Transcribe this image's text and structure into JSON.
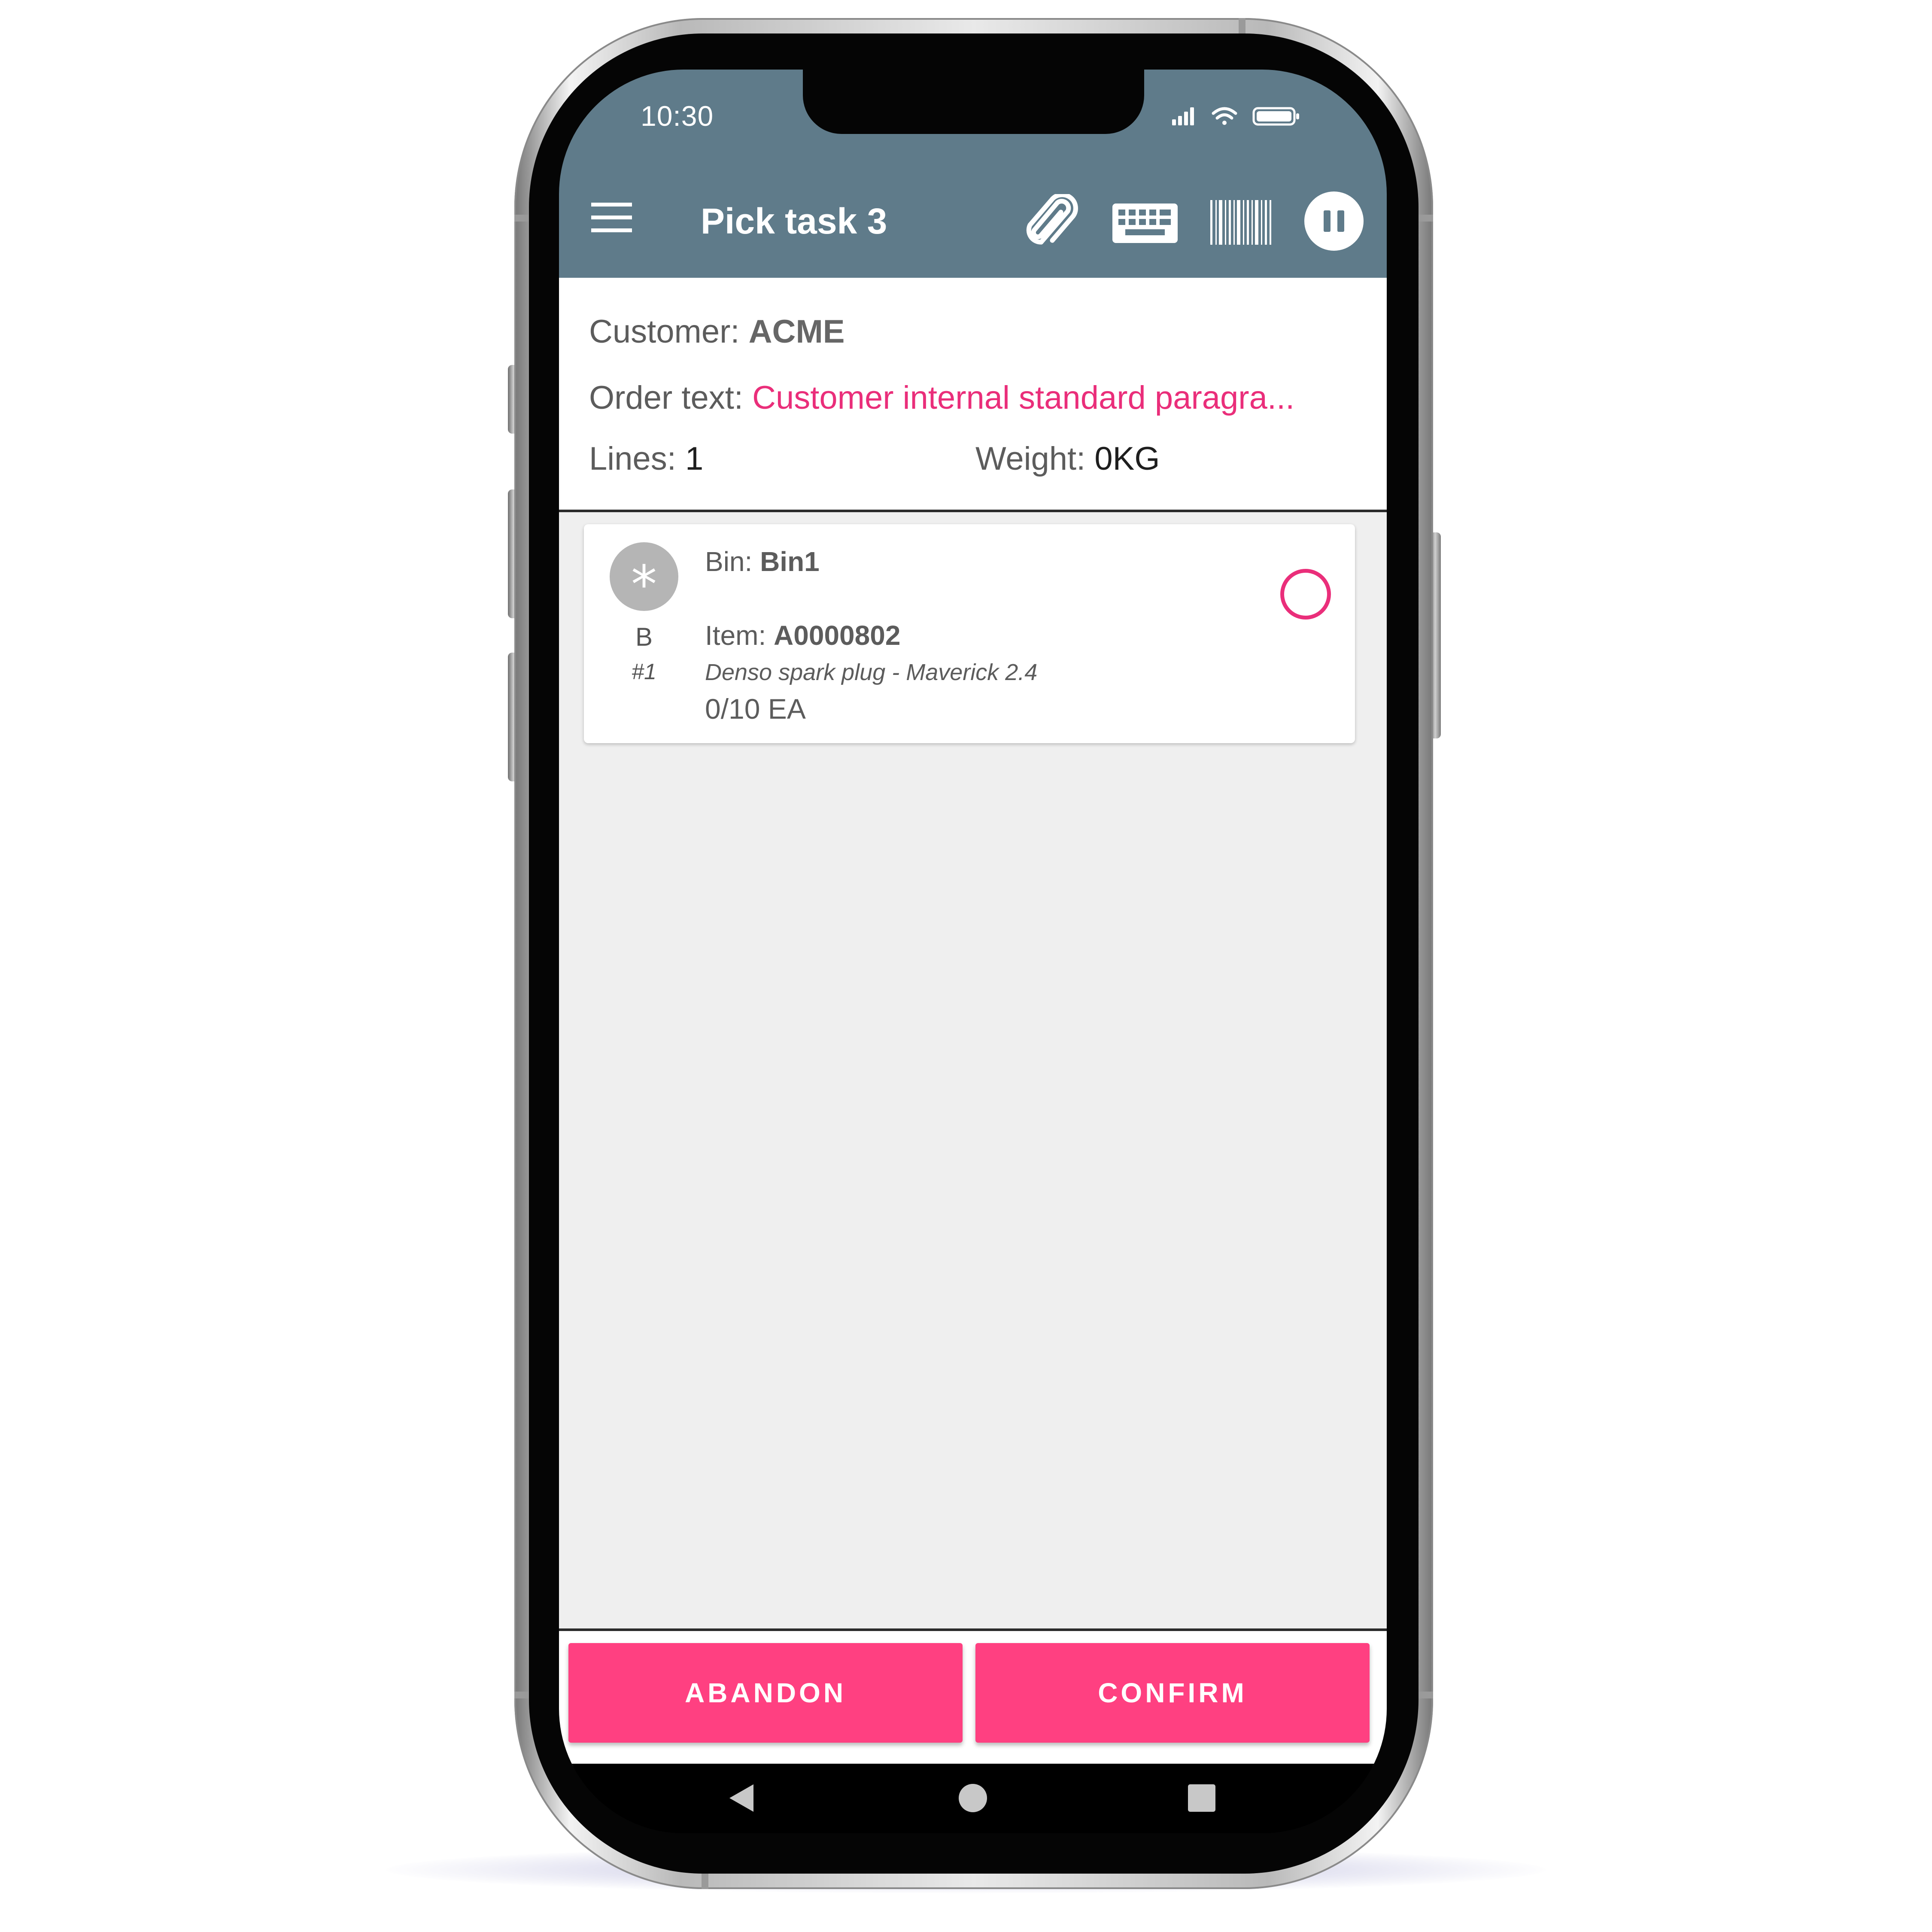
{
  "status_bar": {
    "time": "10:30"
  },
  "app_bar": {
    "title": "Pick task 3",
    "background_color": "#5f7b8a",
    "icons": [
      "menu-icon",
      "paperclip-icon",
      "keyboard-icon",
      "barcode-icon",
      "pause-icon"
    ]
  },
  "header": {
    "customer_label": "Customer:",
    "customer_value": "ACME",
    "order_text_label": "Order text:",
    "order_text_value": "Customer internal standard paragra...",
    "lines_label": "Lines:",
    "lines_value": "1",
    "weight_label": "Weight:",
    "weight_value": "0KG"
  },
  "pick_lines": [
    {
      "avatar_symbol": "*",
      "zone": "B",
      "line_number": "#1",
      "bin_label": "Bin:",
      "bin_value": "Bin1",
      "item_label": "Item:",
      "item_value": "A0000802",
      "description": "Denso spark plug - Maverick 2.4",
      "quantity": "0/10 EA",
      "picked": false
    }
  ],
  "buttons": {
    "abandon": "ABANDON",
    "confirm": "CONFIRM"
  },
  "colors": {
    "accent": "#ff4081",
    "highlight_text": "#ea2e7a",
    "list_background": "#efefef"
  },
  "nav": {
    "icons": [
      "back-icon",
      "home-icon",
      "recents-icon"
    ]
  }
}
